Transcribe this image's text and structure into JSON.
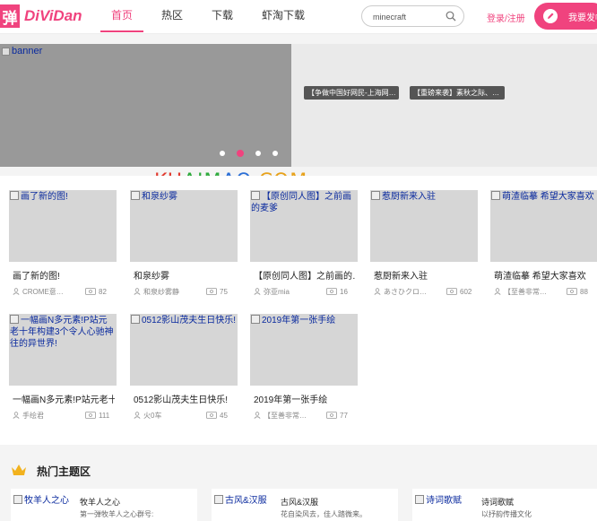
{
  "header": {
    "logo_mark": "弹",
    "logo_text": "DiViDan",
    "nav": [
      "首页",
      "热区",
      "下载",
      "虾淘下载"
    ],
    "search_value": "minecraft",
    "login": "登录/注册",
    "post_button": "我要发帖"
  },
  "colors": {
    "accent": "#f0437e"
  },
  "banner": {
    "main_alt": "banner",
    "tags": [
      "【争做中国好网民-上海网…",
      "【重磅来袭】素秋之际、…"
    ],
    "dots": 4,
    "active_dot": 2
  },
  "watermark": {
    "text": "KUAIMAO.COM",
    "parts": [
      "KU",
      "AIM",
      "AO",
      ".COM"
    ]
  },
  "cards": [
    {
      "alt": "画了新的图!",
      "title": "画了新的图!",
      "author": "CROME意…",
      "views": "82"
    },
    {
      "alt": "和泉纱雾",
      "title": "和泉纱雾",
      "author": "和泉纱雾静",
      "views": "75"
    },
    {
      "alt": "【原创同人图】之前画的麦爹",
      "title": "【原创同人图】之前画的…",
      "author": "弥亚mia",
      "views": "16"
    },
    {
      "alt": "惹厨新来入驻",
      "title": "惹厨新来入驻",
      "author": "あさひクロ…",
      "views": "602"
    },
    {
      "alt": "萌渣临摹 希望大家喜欢",
      "title": "萌渣临摹 希望大家喜欢",
      "author": "【至善非常…",
      "views": "88"
    },
    {
      "alt": "一幅画N多元素!P站元老十年构建3个令人心驰神往的异世界!",
      "title": "一幅画N多元素!P站元老十…",
      "author": "手绘君",
      "views": "111"
    },
    {
      "alt": "0512影山茂夫生日快乐!",
      "title": "0512影山茂夫生日快乐!",
      "author": "火0车",
      "views": "45"
    },
    {
      "alt": "2019年第一张手绘",
      "title": "2019年第一张手绘",
      "author": "【至善非常…",
      "views": "77"
    }
  ],
  "hot": {
    "title": "热门主题区",
    "topics": [
      {
        "alt": "牧羊人之心",
        "name": "牧羊人之心",
        "desc": "第一弹牧羊人之心群号:"
      },
      {
        "alt": "古风&汉服",
        "name": "古风&汉服",
        "desc": "花自染风去，佳人踏微来。"
      },
      {
        "alt": "诗词歌赋",
        "name": "诗词歌赋",
        "desc": "以抒韵传播文化"
      }
    ]
  }
}
